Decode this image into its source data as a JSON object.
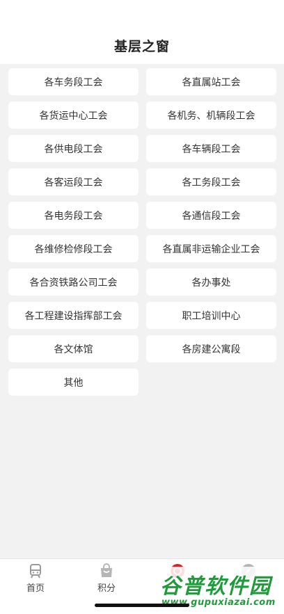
{
  "header": {
    "title": "基层之窗"
  },
  "units": [
    "各车务段工会",
    "各直属站工会",
    "各货运中心工会",
    "各机务、机辆段工会",
    "各供电段工会",
    "各车辆段工会",
    "各客运段工会",
    "各工务段工会",
    "各电务段工会",
    "各通信段工会",
    "各维修检修段工会",
    "各直属非运输企业工会",
    "各合资铁路公司工会",
    "各办事处",
    "各工程建设指挥部工会",
    "职工培训中心",
    "各文体馆",
    "各房建公寓段",
    "其他"
  ],
  "tabbar": {
    "tabs": [
      {
        "label": "首页",
        "icon": "train-icon"
      },
      {
        "label": "积分",
        "icon": "bag-icon"
      },
      {
        "label": "",
        "icon": "red-badge-icon"
      },
      {
        "label": "",
        "icon": "compass-icon"
      }
    ]
  },
  "watermark": {
    "main": "谷普软件园",
    "url": "www.gupuxiazai.com"
  },
  "colors": {
    "accent": "#e02020",
    "watermark": "#1e9c3a"
  }
}
